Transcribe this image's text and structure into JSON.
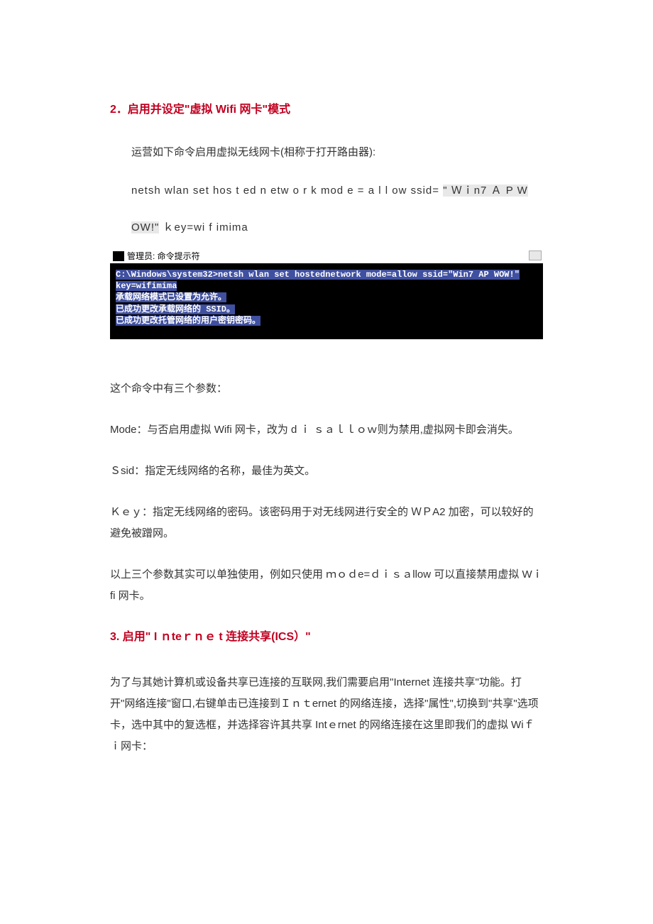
{
  "h2_1": "2．启用并设定\"虚拟 Wifi 网卡\"模式",
  "p1": "运营如下命令启用虚拟无线网卡(相称于打开路由器):",
  "code": {
    "prefix": "netsh wlan  set   hos t ed n etw o r k   mod e = a l l ow ssid= ",
    "hl1": "\" Ｗｉn7  Ａ P  W",
    "hl2": "OW!\"",
    "mid": "   ｋey=wi f imima"
  },
  "term": {
    "title": "管理员: 命令提示符",
    "cmd": "C:\\Windows\\system32>netsh wlan set hostednetwork mode=allow ssid=\"Win7 AP WOW!\" key=wifimima",
    "l1": "承载网络模式已设置为允许。",
    "l2": "已成功更改承载网络的 SSID。",
    "l3": "已成功更改托管网络的用户密钥密码。"
  },
  "d0": "这个命令中有三个参数：",
  "d1": "Mode：与否启用虚拟 Wifi 网卡，改为 d ｉ ｓａｌｌｏｗ则为禁用,虚拟网卡即会消失。",
  "d2": "Ｓsid：指定无线网络的名称，最佳为英文。",
  "d3": "Ｋｅｙ：指定无线网络的密码。该密码用于对无线网进行安全的 ＷＰA2 加密，可以较好的避免被蹭网。",
  "d4": "以上三个参数其实可以单独使用，例如只使用  ｍｏｄe=ｄｉｓａllow  可以直接禁用虚拟 Wｉfi 网卡。",
  "h2_2": "3.    启用\" I ｎteｒｎｅ t 连接共享(ICS）\"",
  "p5": "为了与其她计算机或设备共享已连接的互联网,我们需要启用\"Internet 连接共享\"功能。打开\"网络连接\"窗口,右键单击已连接到Ｉｎｔernet 的网络连接，选择\"属性\",切换到\"共享\"选项卡，选中其中的复选框，并选择容许其共享 Intｅrnet 的网络连接在这里即我们的虚拟 Wiｆｉ网卡："
}
